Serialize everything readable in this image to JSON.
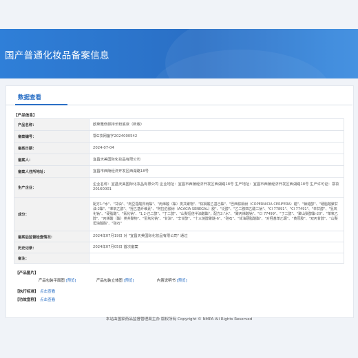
{
  "header": {
    "title": "国产普通化妆品备案信息"
  },
  "tabs": [
    {
      "label": "数据查看"
    }
  ],
  "product_info": {
    "section_title": "【产品信息】",
    "rows": [
      {
        "key": "产品名称：",
        "value": "欧莱雅修颜持长粉底液（新版）"
      },
      {
        "key": "备案编号：",
        "value": "鄂G妆网备字2024000542"
      },
      {
        "key": "备案日期：",
        "value": "2024-07-04"
      },
      {
        "key": "备案人：",
        "value": "宜昌天美国际化妆品有限公司"
      },
      {
        "key": "备案人住所地址：",
        "value": "宜昌市西陵经济开发区西湖路18号"
      },
      {
        "key": "生产企业：",
        "value": "企业名称：宜昌天美国际化妆品有限公司 企业地址：宜昌市西陵经济开发区西湖路18号 生产地址：宜昌市西陵经济开发区西湖路18号 生产许可证：鄂妆20160001"
      },
      {
        "key": "成分：",
        "value": "配方1:\"水\"、\"甘油\"、\"肉豆蔻酸异丙酯\"、\"丙烯酸（酯）类共聚物\"、\"棕榈酸乙基己酯\"、\"巴西棕榈树（COPERNICIA CERIFERA）蜡\"、\"鲸蜡醇\"、\"硬脂酸聚甘油-2酯\"、\"苯氧乙醇\"、\"羟乙基纤维素\"、\"阿拉伯胶树（ACACIA SENEGAL）胶\"、\"泛醇\"、\"乙二胺四乙酸二钠\"、\"CI 77891\"、\"CI 77491\"、\"辛甘醇\"、\"氢氧化钠\"、\"硬脂酸\"、\"氯化钠\"、\"1,2-己二醇\"、\"丁二醇\"、\"山梨坦倍半油酸酯\"；配方2:\"水\"、\"聚丙烯酸钠\"、\"CI 77499\"、\"丁二醇\"、\"聚山梨醇酯-20\"、\"苯氧乙醇\"、\"丙烯酸（酯）类共聚物\"、\"氢氧化钠\"、\"甘油\"、\"辛甘醇\"、\"十三烷醇聚醚-6\"、\"硅石\"、\"甘油硬脂酸酯\"、\"对羟基苯乙酮\"、\"黄原胶\"、\"双丙甘醇\"、\"山梨坦油酸酯\"、\"硅石\""
      },
      {
        "key": "备案后监督检查情况：",
        "value": "2024年07月19日 对 \"宜昌天美国际化妆品有限公司\" 通过"
      },
      {
        "key": "历史记录：",
        "value": "2024年07月05日 首次备案"
      },
      {
        "key": "备注：",
        "value": ""
      }
    ]
  },
  "product_images": {
    "section_title": "【产品图片】",
    "items": [
      {
        "label": "产品包装平面图",
        "link": "[预览]"
      },
      {
        "label": "产品包装立体图",
        "link": "[预览]"
      },
      {
        "label": "内置说明书",
        "link": "[预览]"
      }
    ]
  },
  "standards": {
    "section_title": "【执行标准】",
    "link": "点击查看"
  },
  "efficacy": {
    "section_title": "【功效宣称】",
    "link": "点击查看"
  },
  "footer": {
    "text": "本站由国家药品监督管理局主办 版权所有 Copyright © NMPA All Rights Reserved"
  },
  "colors": {
    "accent": "#2a6fc5",
    "banner": "#2f7fd8",
    "page_bg": "#f0f3f8"
  }
}
